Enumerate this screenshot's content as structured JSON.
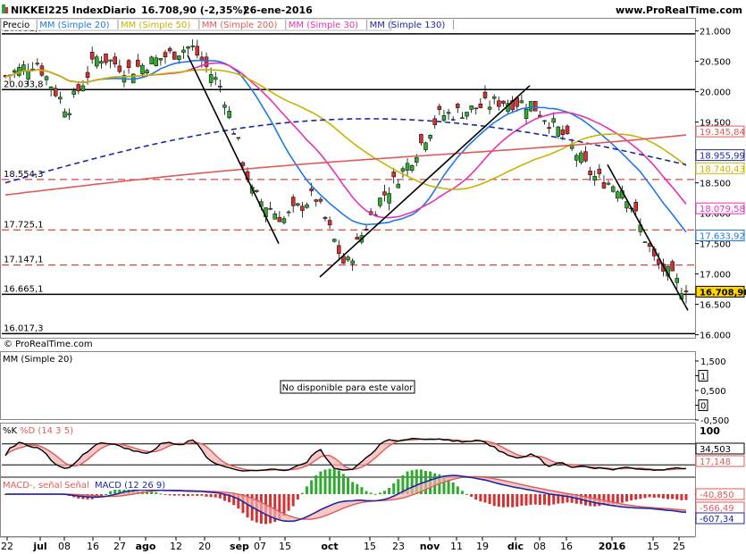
{
  "header": {
    "instrument": "NIKKEI225 Index",
    "period": "Diario",
    "quote": "16.708,90 (-2,35%)",
    "date": "26-ene-2016",
    "website": "www.ProRealTime.com"
  },
  "main_panel": {
    "legend": [
      {
        "label": "Precio",
        "color": "#000000"
      },
      {
        "label": "MM (Simple 20)",
        "color": "#1e78e6"
      },
      {
        "label": "MM (Simple 50)",
        "color": "#c8b400"
      },
      {
        "label": "MM (Simple 200)",
        "color": "#e05a5a"
      },
      {
        "label": "MM (Simple 30)",
        "color": "#e632b4"
      },
      {
        "label": "MM (Simple 130)",
        "color": "#1e28a0"
      }
    ],
    "watermark": "© ProRealTime.com",
    "ylim": [
      15950,
      21200
    ],
    "yticks": [
      {
        "v": 21000,
        "label": "21.000"
      },
      {
        "v": 20500,
        "label": "20.500"
      },
      {
        "v": 20000,
        "label": "20.000"
      },
      {
        "v": 19500,
        "label": "19.500"
      },
      {
        "v": 19000,
        "label": "19.000"
      },
      {
        "v": 18500,
        "label": "18.500"
      },
      {
        "v": 18000,
        "label": "18.000"
      },
      {
        "v": 17500,
        "label": "17.500"
      },
      {
        "v": 17000,
        "label": "17.000"
      },
      {
        "v": 16500,
        "label": "16.500"
      },
      {
        "v": 16000,
        "label": "16.000"
      }
    ],
    "levels": [
      {
        "v": 20952.7,
        "label": "20.952,7",
        "style": "solid"
      },
      {
        "v": 20033.8,
        "label": "20.033,8",
        "style": "solid"
      },
      {
        "v": 18554.3,
        "label": "18.554,3",
        "style": "dash"
      },
      {
        "v": 17725.1,
        "label": "17.725,1",
        "style": "dash"
      },
      {
        "v": 17147.1,
        "label": "17.147,1",
        "style": "dash"
      },
      {
        "v": 16665.1,
        "label": "16.665,1",
        "style": "solid"
      },
      {
        "v": 16017.3,
        "label": "16.017,3",
        "style": "solid"
      }
    ],
    "right_badges": [
      {
        "v": 19345.84,
        "label": "19.345,84",
        "color": "#e05a5a",
        "fill": "#ffffff"
      },
      {
        "v": 18955.99,
        "label": "18.955,99",
        "color": "#1e28a0",
        "fill": "#ffffff"
      },
      {
        "v": 18740.43,
        "label": "18.740,43",
        "color": "#c8b400",
        "fill": "#ffffff"
      },
      {
        "v": 18079.58,
        "label": "18.079,58",
        "color": "#e632b4",
        "fill": "#ffffff"
      },
      {
        "v": 17633.92,
        "label": "17.633,92",
        "color": "#1e78e6",
        "fill": "#ffffff"
      },
      {
        "v": 16708.9,
        "label": "16.708,90",
        "color": "#000000",
        "fill": "#ffd700"
      }
    ]
  },
  "mm_panel": {
    "legend": "MM (Simple 20)",
    "message": "No disponible para este valor",
    "yticks": [
      "1,500",
      "1",
      "0,500",
      "0",
      "-0,500"
    ]
  },
  "stoch_panel": {
    "legend_k": "%K",
    "legend_d": "%D (14 3 5)",
    "yticks": [
      "100"
    ],
    "badges": [
      {
        "label": "34,503",
        "color": "#000000"
      },
      {
        "label": "17,148",
        "color": "#e05a5a"
      }
    ]
  },
  "macd_panel": {
    "legend_macd": "MACD-, señal",
    "legend_signal": "Señal",
    "legend_hist": "MACD (12 26 9)",
    "yticks": [
      "0",
      "-1.000"
    ],
    "badges": [
      {
        "label": "-40,850",
        "color": "#e05a5a"
      },
      {
        "label": "-566,49",
        "color": "#e05a5a"
      },
      {
        "label": "-607,34",
        "color": "#1e28a0"
      }
    ]
  },
  "x_axis": {
    "ticks": [
      "22",
      "jul",
      "08",
      "16",
      "27",
      "ago",
      "12",
      "20",
      "sep",
      "07",
      "15",
      "oct",
      "15",
      "23",
      "nov",
      "11",
      "19",
      "dic",
      "08",
      "16",
      "2016",
      "15",
      "25"
    ]
  },
  "chart_data": {
    "type": "candlestick",
    "title": "NIKKEI225 Index",
    "ylabel": "Precio",
    "ylim": [
      15950,
      21200
    ],
    "checkpoints": [
      {
        "x": "22",
        "close": 20250
      },
      {
        "x": "jul",
        "close": 20500
      },
      {
        "x": "08",
        "close": 19700
      },
      {
        "x": "16",
        "close": 20600
      },
      {
        "x": "27",
        "close": 20350
      },
      {
        "x": "ago",
        "close": 20550
      },
      {
        "x": "12",
        "close": 20750
      },
      {
        "x": "20",
        "close": 20050
      },
      {
        "x": "sep",
        "close": 18300
      },
      {
        "x": "07",
        "close": 17900
      },
      {
        "x": "15",
        "close": 18300
      },
      {
        "x": "oct",
        "close": 17100
      },
      {
        "x": "15",
        "close": 18150
      },
      {
        "x": "23",
        "close": 18800
      },
      {
        "x": "nov",
        "close": 19600
      },
      {
        "x": "11",
        "close": 19700
      },
      {
        "x": "19",
        "close": 19850
      },
      {
        "x": "dic",
        "close": 19800
      },
      {
        "x": "08",
        "close": 19300
      },
      {
        "x": "16",
        "close": 18600
      },
      {
        "x": "2016",
        "close": 18400
      },
      {
        "x": "15",
        "close": 17200
      },
      {
        "x": "25",
        "close": 16708.9
      }
    ],
    "last": {
      "value": 16708.9,
      "change_pct": -2.35,
      "date": "26-ene-2016"
    },
    "moving_averages_last": {
      "MM (Simple 20)": 17633.92,
      "MM (Simple 30)": 18079.58,
      "MM (Simple 50)": 18740.43,
      "MM (Simple 130)": 18955.99,
      "MM (Simple 200)": 19345.84
    }
  }
}
